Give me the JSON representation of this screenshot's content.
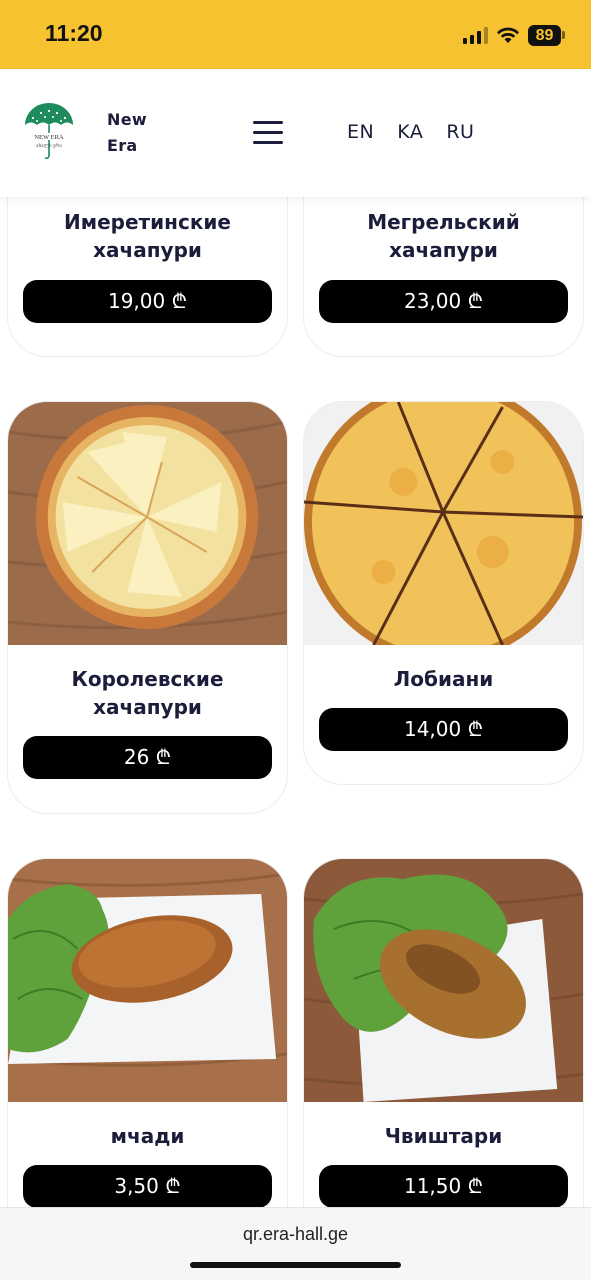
{
  "status_bar": {
    "time": "11:20",
    "battery": "89"
  },
  "header": {
    "brand_line1": "New",
    "brand_line2": "Era",
    "languages": [
      "EN",
      "KA",
      "RU"
    ]
  },
  "menu": {
    "items": [
      {
        "name": "Имеретинские хачапури",
        "price": "19,00 ₾"
      },
      {
        "name": "Мегрельский хачапури",
        "price": "23,00 ₾"
      },
      {
        "name": "Королевские хачапури",
        "price": "26 ₾"
      },
      {
        "name": "Лобиани",
        "price": "14,00 ₾"
      },
      {
        "name": "мчади",
        "price": "3,50 ₾"
      },
      {
        "name": "Чвиштари",
        "price": "11,50 ₾"
      }
    ]
  },
  "footer": {
    "url": "qr.era-hall.ge"
  }
}
